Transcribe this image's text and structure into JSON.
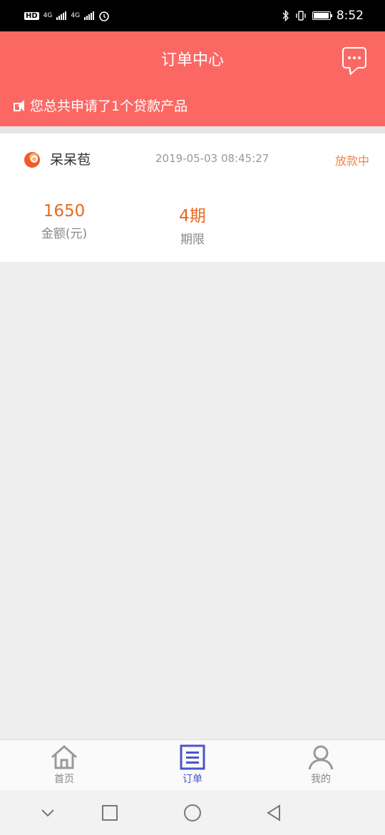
{
  "status_bar": {
    "hd": "HD",
    "net1": "4G",
    "net2": "4G",
    "time": "8:52"
  },
  "header": {
    "title": "订单中心",
    "notice": "您总共申请了1个贷款产品"
  },
  "order": {
    "product_name": "呆呆苞",
    "time": "2019-05-03 08:45:27",
    "status": "放款中",
    "amount_value": "1650",
    "amount_label": "金额(元)",
    "term_value": "4期",
    "term_label": "期限"
  },
  "tabs": [
    {
      "label": "首页",
      "icon": "home-icon",
      "active": false
    },
    {
      "label": "订单",
      "icon": "order-list-icon",
      "active": true
    },
    {
      "label": "我的",
      "icon": "person-icon",
      "active": false
    }
  ],
  "colors": {
    "header_bg": "#fb6864",
    "accent_orange": "#e8691f",
    "status_orange": "#f5834a",
    "tab_active": "#4b54c9",
    "tab_inactive": "#888888"
  }
}
